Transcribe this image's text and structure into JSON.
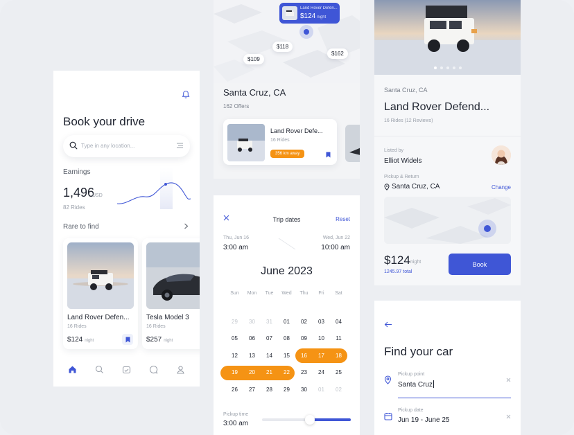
{
  "home": {
    "title": "Book your drive",
    "search_placeholder": "Type in any location...",
    "earnings_label": "Earnings",
    "earnings_value": "1,496",
    "earnings_unit": "USD",
    "earnings_rides": "82 Rides",
    "rare_label": "Rare to find",
    "cars": [
      {
        "name": "Land Rover Defen...",
        "rides": "16 Rides",
        "price": "$124",
        "unit": "night"
      },
      {
        "name": "Tesla Model 3",
        "rides": "16 Rides",
        "price": "$257",
        "unit": "night"
      }
    ],
    "nav": [
      "home-icon",
      "search-icon",
      "calendar-icon",
      "chat-icon",
      "profile-icon"
    ]
  },
  "map": {
    "bubble_name": "Land Rover Defen...",
    "bubble_price": "$124",
    "bubble_unit": "night",
    "pins": [
      "$118",
      "$109",
      "$162"
    ],
    "location": "Santa Cruz, CA",
    "offers": "162 Offers",
    "card": {
      "name": "Land Rover Defe...",
      "rides": "16 Rides",
      "distance": "356 km away"
    }
  },
  "dates": {
    "title": "Trip dates",
    "reset": "Reset",
    "start_label": "Thu, Jun 16",
    "start_time": "3:00 am",
    "end_label": "Wed, Jun 22",
    "end_time": "10:00 am",
    "month": "June 2023",
    "weekdays": [
      "Sun",
      "Mon",
      "Tue",
      "Wed",
      "Thu",
      "Fri",
      "Sat"
    ],
    "weeks": [
      [
        "29",
        "30",
        "31",
        "01",
        "02",
        "03",
        "04"
      ],
      [
        "05",
        "06",
        "07",
        "08",
        "09",
        "10",
        "11"
      ],
      [
        "12",
        "13",
        "14",
        "15",
        "16",
        "17",
        "18"
      ],
      [
        "19",
        "20",
        "21",
        "22",
        "23",
        "24",
        "25"
      ],
      [
        "26",
        "27",
        "28",
        "29",
        "30",
        "01",
        "02"
      ]
    ],
    "pickup_label": "Pickup time",
    "pickup_value": "3:00 am"
  },
  "details": {
    "location": "Santa Cruz, CA",
    "name": "Land Rover Defend...",
    "rides": "16 Rides (12 Reviews)",
    "listed_label": "Listed by",
    "listed_name": "Elliot Widels",
    "pickup_label": "Pickup & Return",
    "pickup_value": "Santa Cruz, CA",
    "change": "Change",
    "price": "$124",
    "price_unit": "night",
    "total": "1245.97 total",
    "book": "Book"
  },
  "find": {
    "title": "Find your car",
    "pickup_point_label": "Pickup point",
    "pickup_point_value": "Santa Cruz",
    "pickup_date_label": "Pickup date",
    "pickup_date_value": "Jun 19 - June 25"
  },
  "colors": {
    "accent": "#3f56d6",
    "orange": "#f59314"
  }
}
